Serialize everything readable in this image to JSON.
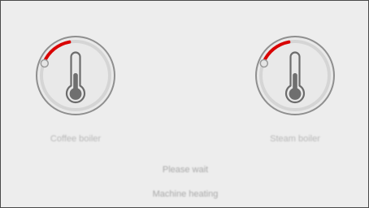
{
  "gauges": [
    {
      "label": "Coffee boiler",
      "icon": "thermometer-icon",
      "progress": 0.18,
      "accent": "#d90000",
      "track": "#d6d6d6"
    },
    {
      "label": "Steam boiler",
      "icon": "thermometer-icon",
      "progress": 0.18,
      "accent": "#d90000",
      "track": "#d6d6d6"
    }
  ],
  "status": {
    "line1": "Please wait",
    "line2": "Machine heating"
  }
}
